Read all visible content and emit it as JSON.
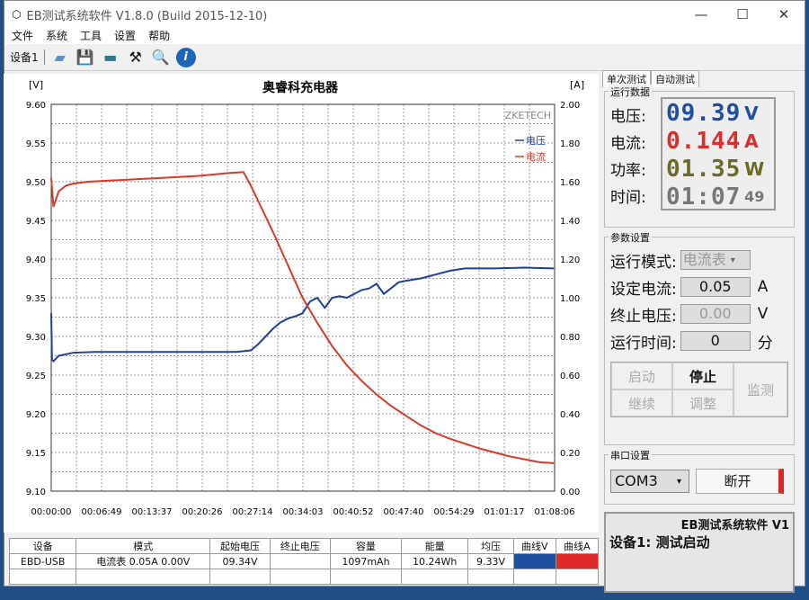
{
  "window": {
    "title": "EB测试系统软件 V1.8.0 (Build 2015-12-10)",
    "minimize": "—",
    "maximize": "☐",
    "close": "✕"
  },
  "menu": [
    "文件",
    "系统",
    "工具",
    "设置",
    "帮助"
  ],
  "toolbar": {
    "device_tab": "设备1"
  },
  "chart_data": {
    "type": "line",
    "title": "奥睿科充电器",
    "watermark": "ZKETECH",
    "ylabel_left": "[V]",
    "ylabel_right": "[A]",
    "ylim_left": [
      9.1,
      9.6
    ],
    "ylim_right": [
      0,
      2.0
    ],
    "yticks_left": [
      "9.60",
      "9.55",
      "9.50",
      "9.45",
      "9.40",
      "9.35",
      "9.30",
      "9.25",
      "9.20",
      "9.15",
      "9.10"
    ],
    "yticks_right": [
      "2.00",
      "1.80",
      "1.60",
      "1.40",
      "1.20",
      "1.00",
      "0.80",
      "0.60",
      "0.40",
      "0.20",
      "0.00"
    ],
    "xlim_minutes": [
      0,
      68.1
    ],
    "xticks": [
      "00:00:00",
      "00:06:49",
      "00:13:37",
      "00:20:26",
      "00:27:14",
      "00:34:03",
      "00:40:52",
      "00:47:40",
      "00:54:29",
      "01:01:17",
      "01:08:06"
    ],
    "grid": true,
    "legend_position": "top-right",
    "series": [
      {
        "name": "电压",
        "axis": "left",
        "color": "#1f3f99",
        "x": [
          0,
          0.1,
          0.3,
          1,
          3,
          6,
          10,
          15,
          20,
          25,
          27,
          28,
          29,
          30,
          31,
          32,
          33,
          34,
          35,
          36,
          37,
          38,
          39,
          40,
          41,
          42,
          43,
          44,
          45,
          47,
          48,
          50,
          52,
          54,
          56,
          60,
          64,
          68
        ],
        "y": [
          9.33,
          9.27,
          9.268,
          9.275,
          9.279,
          9.28,
          9.28,
          9.28,
          9.28,
          9.28,
          9.282,
          9.29,
          9.3,
          9.31,
          9.318,
          9.323,
          9.326,
          9.33,
          9.345,
          9.35,
          9.337,
          9.35,
          9.352,
          9.35,
          9.355,
          9.36,
          9.362,
          9.368,
          9.355,
          9.37,
          9.372,
          9.375,
          9.38,
          9.385,
          9.388,
          9.388,
          9.389,
          9.388
        ]
      },
      {
        "name": "电流",
        "axis": "right",
        "color": "#d83a2a",
        "x": [
          0,
          0.3,
          1,
          2,
          3,
          5,
          10,
          15,
          20,
          24,
          26,
          27,
          28,
          29,
          30,
          32,
          34,
          36,
          38,
          40,
          42,
          44,
          46,
          48,
          50,
          52,
          54,
          56,
          58,
          60,
          62,
          64,
          66,
          68
        ],
        "y": [
          1.62,
          1.47,
          1.55,
          1.58,
          1.59,
          1.6,
          1.61,
          1.62,
          1.63,
          1.645,
          1.65,
          1.58,
          1.5,
          1.42,
          1.34,
          1.17,
          1.0,
          0.87,
          0.75,
          0.65,
          0.57,
          0.5,
          0.44,
          0.39,
          0.34,
          0.3,
          0.27,
          0.245,
          0.22,
          0.2,
          0.18,
          0.165,
          0.15,
          0.145
        ]
      }
    ]
  },
  "table": {
    "headers": [
      "设备",
      "模式",
      "起始电压",
      "终止电压",
      "容量",
      "能量",
      "均压",
      "曲线V",
      "曲线A"
    ],
    "row": [
      "EBD-USB",
      "电流表  0.05A  0.00V",
      "09.34V",
      "",
      "1097mAh",
      "10.24Wh",
      "9.33V",
      "",
      ""
    ],
    "curve_colors": [
      "#1f4fa0",
      "#e02828"
    ]
  },
  "panel": {
    "tabs": [
      "单次测试",
      "自动测试"
    ],
    "run_data": {
      "legend": "运行数据",
      "labels": [
        "电压:",
        "电流:",
        "功率:",
        "时间:"
      ],
      "voltage": "09.39",
      "voltage_unit": "V",
      "current": "0.144",
      "current_unit": "A",
      "power": "01.35",
      "power_unit": "W",
      "time": "01:07",
      "time_sec": "49",
      "colors": [
        "#1f4fa0",
        "#d83030",
        "#6b6b2a",
        "#777777"
      ]
    },
    "params": {
      "legend": "参数设置",
      "mode_label": "运行模式:",
      "mode_value": "电流表",
      "current_label": "设定电流:",
      "current_value": "0.05",
      "current_unit": "A",
      "stopv_label": "终止电压:",
      "stopv_value": "0.00",
      "stopv_unit": "V",
      "time_label": "运行时间:",
      "time_value": "0",
      "time_unit": "分"
    },
    "buttons": {
      "start": "启动",
      "stop": "停止",
      "monitor": "监测",
      "continue": "继续",
      "adjust": "调整"
    },
    "serial": {
      "legend": "串口设置",
      "port": "COM3",
      "disconnect": "断开"
    },
    "log": {
      "line1": "EB测试系统软件 V1",
      "line2": "设备1: 测试启动"
    }
  }
}
